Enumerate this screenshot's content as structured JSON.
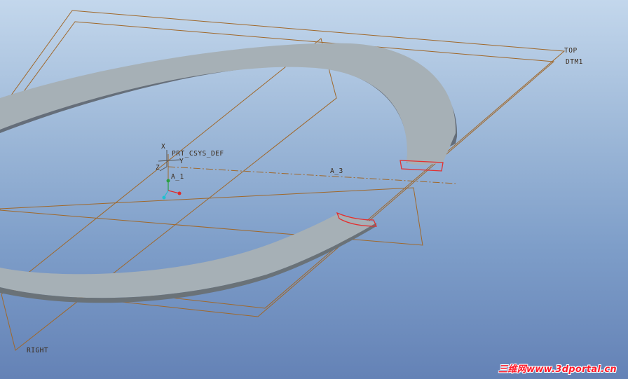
{
  "viewport": {
    "background_top": "#c3d7ec",
    "background_bottom": "#6482b6"
  },
  "model": {
    "ring_color": "#a6b0b6",
    "ring_shadow_color": "#5a6068",
    "datum_color": "#a0682a",
    "highlight_color": "#e23030"
  },
  "datum_planes": {
    "top_label": "TOP",
    "dtm1_label": "DTM1",
    "right_label": "RIGHT"
  },
  "datum_axes": {
    "a1_label": "A_1",
    "a3_label": "A_3"
  },
  "coordinate_system": {
    "label": "PRT_CSYS_DEF",
    "x_label": "X",
    "y_label": "Y",
    "z_label": "Z"
  },
  "watermark": {
    "text": "三维网www.3dportal.cn"
  }
}
